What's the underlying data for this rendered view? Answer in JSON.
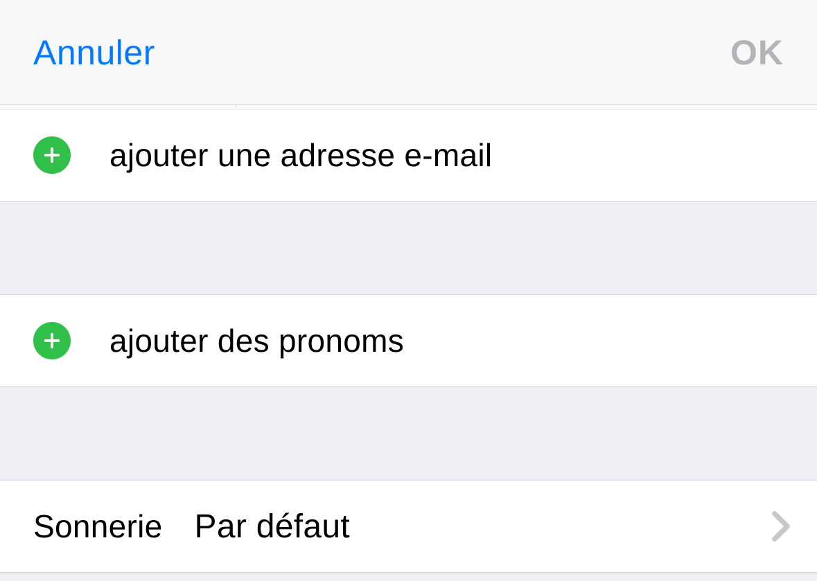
{
  "header": {
    "cancel_label": "Annuler",
    "ok_label": "OK"
  },
  "rows": {
    "add_email_label": "ajouter une adresse e-mail",
    "add_pronouns_label": "ajouter des pronoms"
  },
  "ringtone": {
    "key": "Sonnerie",
    "value": "Par défaut"
  },
  "colors": {
    "accent": "#007aff",
    "add_green": "#30c04a",
    "disabled_text": "#b4b4b8"
  }
}
